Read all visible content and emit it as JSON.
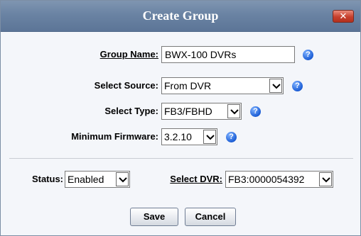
{
  "dialog": {
    "title": "Create Group",
    "close_label": "✕"
  },
  "form": {
    "group_name": {
      "label": "Group Name:",
      "value": "BWX-100 DVRs"
    },
    "select_source": {
      "label": "Select Source:",
      "value": "From DVR"
    },
    "select_type": {
      "label": "Select Type:",
      "value": "FB3/FBHD"
    },
    "minimum_firmware": {
      "label": "Minimum Firmware:",
      "value": "3.2.10"
    },
    "help_glyph": "?"
  },
  "filters": {
    "status": {
      "label": "Status:",
      "value": "Enabled"
    },
    "select_dvr": {
      "label": "Select DVR:",
      "value": "FB3:0000054392"
    }
  },
  "actions": {
    "save_label": "Save",
    "cancel_label": "Cancel"
  },
  "colors": {
    "titlebar": "#6a83a3",
    "close_button": "#c7402d",
    "help_icon": "#1c5ed6"
  }
}
